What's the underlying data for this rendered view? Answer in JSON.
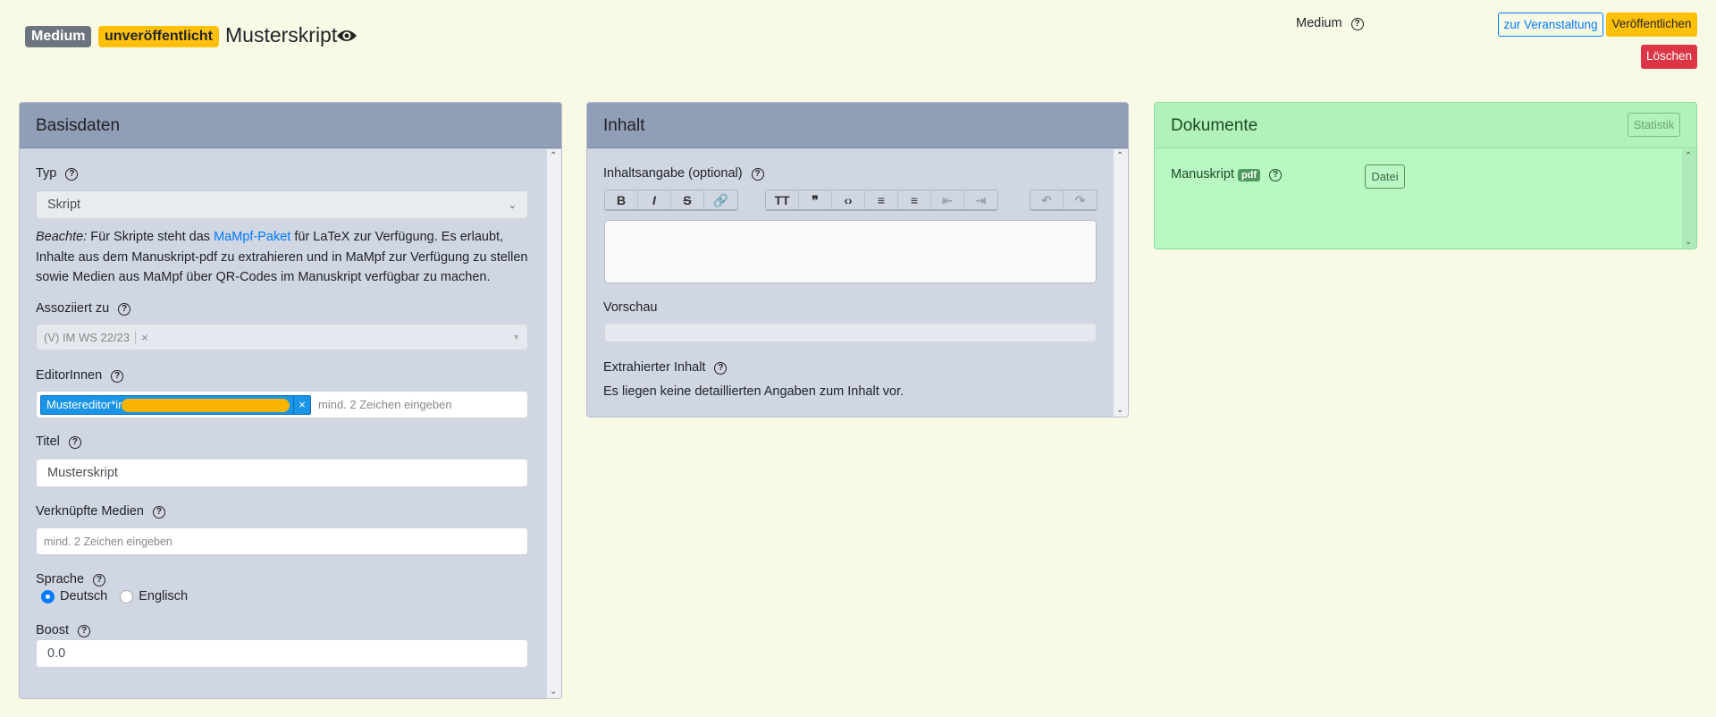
{
  "header": {
    "badge_type": "Medium",
    "badge_status": "unveröffentlicht",
    "title": "Musterskript",
    "type_label": "Medium",
    "buttons": {
      "event": "zur Veranstaltung",
      "publish": "Veröffentlichen",
      "delete": "Löschen"
    }
  },
  "basis": {
    "title": "Basisdaten",
    "typ_label": "Typ",
    "typ_value": "Skript",
    "note_em": "Beachte:",
    "note_1": " Für Skripte steht das ",
    "note_link": "MaMpf-Paket",
    "note_2": " für LaTeX zur Verfügung. Es erlaubt, Inhalte aus dem Manuskript-pdf zu extrahieren und in MaMpf zur Verfügung zu stellen sowie Medien aus MaMpf über QR-Codes im Manuskript verfügbar zu machen.",
    "assoc_label": "Assoziiert zu",
    "assoc_value": "(V) IM WS 22/23",
    "remove": "×",
    "editors_label": "EditorInnen",
    "editor_tag": "Mustereditor*in",
    "editors_placeholder": "mind. 2 Zeichen eingeben",
    "titel_label": "Titel",
    "titel_value": "Musterskript",
    "media_label": "Verknüpfte Medien",
    "media_placeholder": "mind. 2 Zeichen eingeben",
    "lang_label": "Sprache",
    "lang_options": [
      "Deutsch",
      "Englisch"
    ],
    "lang_selected": "Deutsch",
    "boost_label": "Boost",
    "boost_value": "0.0"
  },
  "inhalt": {
    "title": "Inhalt",
    "summary_label": "Inhaltsangabe (optional)",
    "preview_label": "Vorschau",
    "extracted_label": "Extrahierter Inhalt",
    "extracted_text": "Es liegen keine detaillierten Angaben zum Inhalt vor."
  },
  "docs": {
    "title": "Dokumente",
    "stats": "Statistik",
    "manuscript_label": "Manuskript",
    "pdf_badge": "pdf",
    "file_button": "Datei"
  },
  "colors": {
    "primary": "#007bff",
    "warning": "#ffc107",
    "danger": "#dc3545",
    "secondary": "#6c757d"
  }
}
